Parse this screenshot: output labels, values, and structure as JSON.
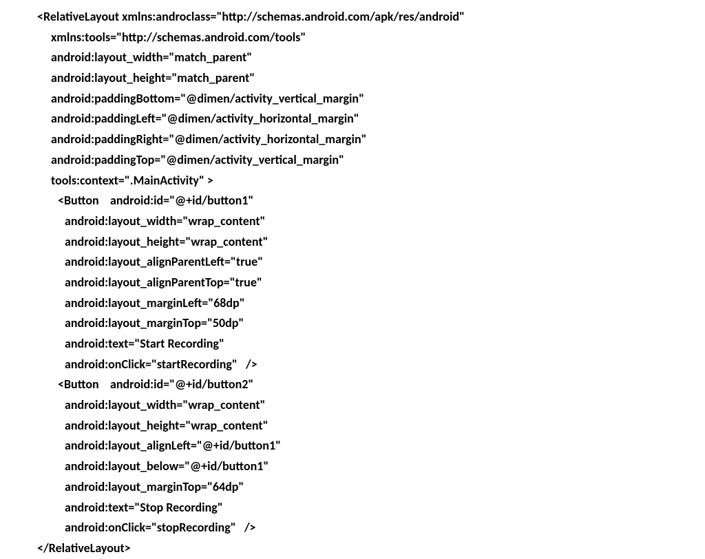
{
  "lines": [
    {
      "indent": 0,
      "text": "<RelativeLayout xmlns:androclass=\"http://schemas.android.com/apk/res/android\""
    },
    {
      "indent": 1,
      "text": "xmlns:tools=\"http://schemas.android.com/tools\""
    },
    {
      "indent": 1,
      "text": "android:layout_width=\"match_parent\""
    },
    {
      "indent": 1,
      "text": "android:layout_height=\"match_parent\""
    },
    {
      "indent": 1,
      "text": "android:paddingBottom=\"@dimen/activity_vertical_margin\""
    },
    {
      "indent": 1,
      "text": "android:paddingLeft=\"@dimen/activity_horizontal_margin\""
    },
    {
      "indent": 1,
      "text": "android:paddingRight=\"@dimen/activity_horizontal_margin\""
    },
    {
      "indent": 1,
      "text": "android:paddingTop=\"@dimen/activity_vertical_margin\""
    },
    {
      "indent": 1,
      "text": "tools:context=\".MainActivity\" >"
    },
    {
      "indent": 2,
      "text": "<Button    android:id=\"@+id/button1\""
    },
    {
      "indent": 3,
      "text": "android:layout_width=\"wrap_content\""
    },
    {
      "indent": 3,
      "text": "android:layout_height=\"wrap_content\""
    },
    {
      "indent": 3,
      "text": "android:layout_alignParentLeft=\"true\""
    },
    {
      "indent": 3,
      "text": "android:layout_alignParentTop=\"true\""
    },
    {
      "indent": 3,
      "text": "android:layout_marginLeft=\"68dp\""
    },
    {
      "indent": 3,
      "text": "android:layout_marginTop=\"50dp\""
    },
    {
      "indent": 3,
      "text": "android:text=\"Start Recording\""
    },
    {
      "indent": 3,
      "text": "android:onClick=\"startRecording\"   />"
    },
    {
      "indent": 2,
      "text": "<Button    android:id=\"@+id/button2\""
    },
    {
      "indent": 3,
      "text": "android:layout_width=\"wrap_content\""
    },
    {
      "indent": 3,
      "text": "android:layout_height=\"wrap_content\""
    },
    {
      "indent": 3,
      "text": "android:layout_alignLeft=\"@+id/button1\""
    },
    {
      "indent": 3,
      "text": "android:layout_below=\"@+id/button1\""
    },
    {
      "indent": 3,
      "text": "android:layout_marginTop=\"64dp\""
    },
    {
      "indent": 3,
      "text": "android:text=\"Stop Recording\""
    },
    {
      "indent": 3,
      "text": "android:onClick=\"stopRecording\"   />"
    },
    {
      "indent": 0,
      "text": "</RelativeLayout>"
    }
  ]
}
